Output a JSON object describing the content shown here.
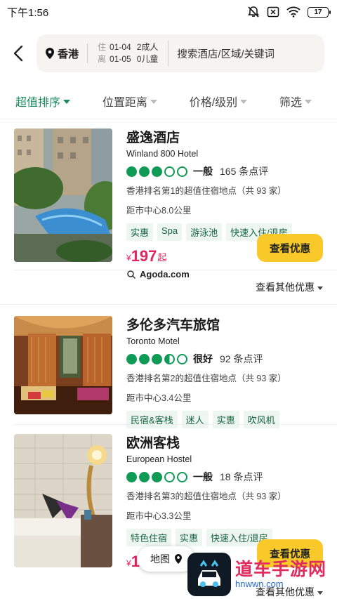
{
  "status_bar": {
    "time": "下午1:56",
    "battery": "17"
  },
  "search": {
    "location": "香港",
    "checkin_label": "住",
    "checkin_date": "01-04",
    "guests_adults": "2成人",
    "checkout_label": "离",
    "checkout_date": "01-05",
    "guests_children": "0儿童",
    "query": "搜索酒店/区域/关键词"
  },
  "filters": [
    {
      "label": "超值排序"
    },
    {
      "label": "位置距离"
    },
    {
      "label": "价格/级别"
    },
    {
      "label": "筛选"
    }
  ],
  "colors": {
    "accent": "#1a8a5c",
    "bubble": "#0f9a56",
    "price": "#e0245e",
    "button": "#f8c928"
  },
  "hotels": [
    {
      "name": "盛逸酒店",
      "name_en": "Winland 800 Hotel",
      "rating_bubbles": 3,
      "rating_word": "一般",
      "reviews": "165 条点评",
      "rank": "香港排名第1的超值住宿地点（共 93 家）",
      "distance": "距市中心8.0公里",
      "tags": [
        "实惠",
        "Spa",
        "游泳池",
        "快速入住/退房"
      ],
      "price_symbol": "¥",
      "price": "197",
      "price_suffix": "起",
      "vendor": "Agoda.com",
      "deal_button": "查看优惠",
      "more_deals": "查看其他优惠"
    },
    {
      "name": "多伦多汽车旅馆",
      "name_en": "Toronto Motel",
      "rating_bubbles": 3.5,
      "rating_word": "很好",
      "reviews": "92 条点评",
      "rank": "香港排名第2的超值住宿地点（共 93 家）",
      "distance": "距市中心3.4公里",
      "tags": [
        "民宿&客栈",
        "迷人",
        "实惠",
        "吹风机"
      ]
    },
    {
      "name": "欧洲客栈",
      "name_en": "European Hostel",
      "rating_bubbles": 3,
      "rating_word": "一般",
      "reviews": "18 条点评",
      "rank": "香港排名第3的超值住宿地点（共 93 家）",
      "distance": "距市中心3.3公里",
      "tags": [
        "特色住宿",
        "实惠",
        "快速入住/退房"
      ],
      "price_symbol": "¥",
      "price": "198",
      "deal_button": "查看优惠",
      "more_deals": "查看其他优惠"
    }
  ],
  "map_button": "地图",
  "watermark": {
    "title": "道车手游网",
    "url": "hnwwn.com"
  }
}
